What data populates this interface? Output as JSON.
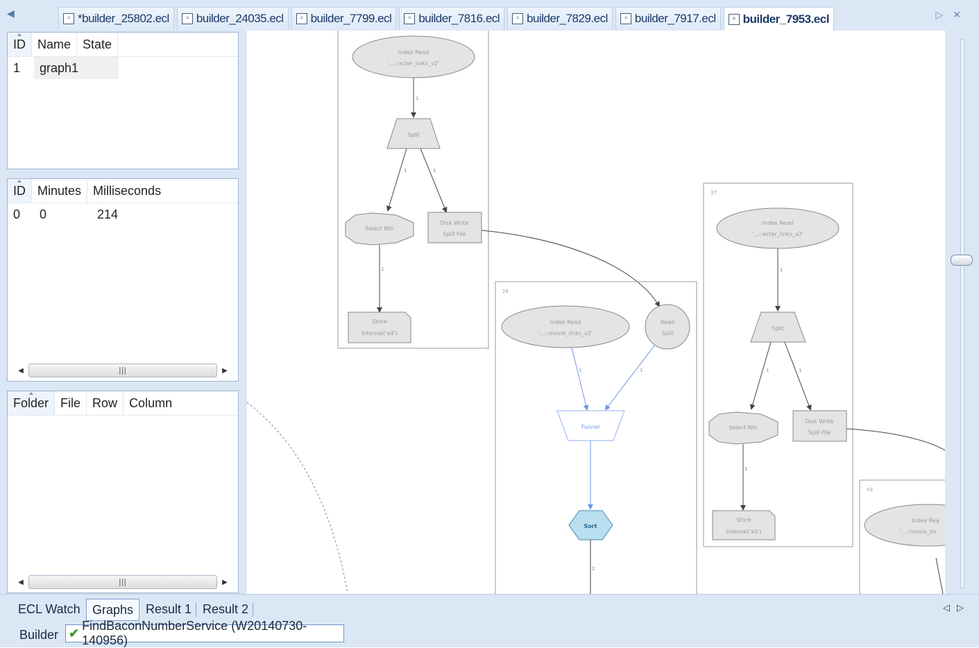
{
  "tabs": [
    {
      "label": "*builder_25802.ecl",
      "active": false
    },
    {
      "label": "builder_24035.ecl",
      "active": false
    },
    {
      "label": "builder_7799.ecl",
      "active": false
    },
    {
      "label": "builder_7816.ecl",
      "active": false
    },
    {
      "label": "builder_7829.ecl",
      "active": false
    },
    {
      "label": "builder_7917.ecl",
      "active": false
    },
    {
      "label": "builder_7953.ecl",
      "active": true
    }
  ],
  "graphs_panel": {
    "columns": [
      "ID",
      "Name",
      "State"
    ],
    "rows": [
      {
        "id": "1",
        "name": "graph1",
        "state": ""
      }
    ]
  },
  "timing_panel": {
    "columns": [
      "ID",
      "Minutes",
      "Milliseconds"
    ],
    "rows": [
      {
        "id": "0",
        "minutes": "0",
        "ms": "214"
      }
    ]
  },
  "files_panel": {
    "columns": [
      "Folder",
      "File",
      "Row",
      "Column"
    ]
  },
  "graph": {
    "subgraph_37_label": "37",
    "subgraph_28_label": "28",
    "subgraph_43_label": "43",
    "nodes": {
      "a_index_read": "Index Read",
      "a_index_read_sub": "'...::acter_links_v2'",
      "a_split": "Split",
      "a_select_nth": "Select Nth",
      "a_disk_write": "Disk Write",
      "a_disk_write_sub": "Spill File",
      "a_store": "Store",
      "a_store_sub": "Internal('a4')",
      "b_index_read": "Index Read",
      "b_index_read_sub": "'...::movie_links_v2'",
      "b_read_spill": "Read",
      "b_read_spill_sub": "Spill",
      "b_funnel": "Funnel",
      "b_sort": "Sort",
      "c_index_read": "Index Read",
      "c_index_read_sub": "'...::acter_links_v2'",
      "c_split": "Split",
      "c_select_nth": "Select Nth",
      "c_disk_write": "Disk Write",
      "c_disk_write_sub": "Spill File",
      "c_store": "Store",
      "c_store_sub": "Internal('a5')",
      "d_index_read": "Index Rea",
      "d_index_read_sub": "'...::movie_lin"
    },
    "edge_labels": {
      "one": "1",
      "two": "2"
    }
  },
  "bottom_tabs": [
    {
      "label": "ECL Watch",
      "active": false
    },
    {
      "label": "Graphs",
      "active": true
    },
    {
      "label": "Result 1",
      "active": false
    },
    {
      "label": "Result 2",
      "active": false
    }
  ],
  "builder": {
    "label": "Builder",
    "value": "FindBaconNumberService (W20140730-140956)"
  },
  "colors": {
    "accent": "#7aa0d1",
    "chrome": "#dbe7f5",
    "node_fill": "#e4e4e4",
    "funnel_stroke": "#8fb2f0",
    "sort_fill": "#b9dff0"
  },
  "icons": [
    "scroll-left-icon",
    "file-icon",
    "scroll-right-icon",
    "close-icon",
    "check-icon"
  ]
}
